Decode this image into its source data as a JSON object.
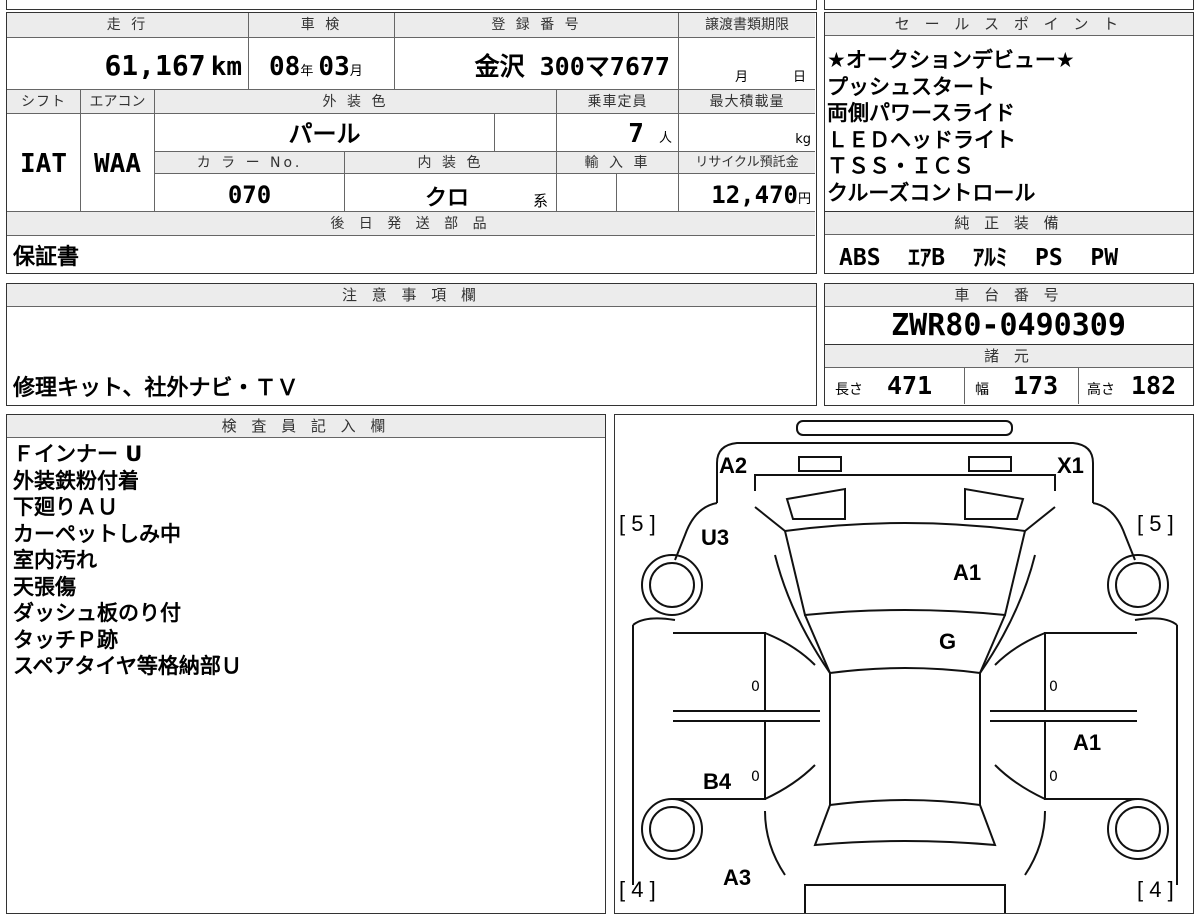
{
  "vehicle": {
    "mileage_label": "走 行",
    "mileage_value": "61,167",
    "mileage_unit": "km",
    "inspection_label": "車 検",
    "inspection_year": "08",
    "inspection_year_unit": "年",
    "inspection_month": "03",
    "inspection_month_unit": "月",
    "registration_label": "登 録 番 号",
    "registration_value": "金沢 300マ7677",
    "transfer_deadline_label": "譲渡書類期限",
    "transfer_month_unit": "月",
    "transfer_day_unit": "日",
    "shift_label": "シフト",
    "shift_value": "IAT",
    "aircon_label": "エアコン",
    "aircon_value": "WAA",
    "exterior_color_label": "外 装 色",
    "exterior_color_value": "パール",
    "capacity_label": "乗車定員",
    "capacity_value": "7",
    "capacity_unit": "人",
    "max_load_label": "最大積載量",
    "max_load_unit": "kg",
    "color_no_label": "カ ラ ー No.",
    "color_no_value": "070",
    "interior_color_label": "内 装 色",
    "interior_color_value": "クロ",
    "interior_color_suffix": "系",
    "import_label": "輸 入 車",
    "recycle_label": "リサイクル預託金",
    "recycle_value": "12,470",
    "recycle_unit": "円",
    "later_parts_label": "後 日 発 送 部 品",
    "later_parts_value": "保証書"
  },
  "sales_points": {
    "label": "セ ー ル ス ポ イ ン ト",
    "items": [
      "★オークションデビュー★",
      "プッシュスタート",
      "両側パワースライド",
      "ＬＥＤヘッドライト",
      "ＴＳＳ・ＩＣＳ",
      "クルーズコントロール"
    ]
  },
  "genuine_equipment": {
    "label": "純 正 装 備",
    "value": "ABS  ｴｱB  ｱﾙﾐ  PS  PW"
  },
  "notes": {
    "label": "注 意 事 項 欄",
    "value": "修理キット、社外ナビ・ＴＶ"
  },
  "chassis": {
    "label": "車 台 番 号",
    "value": "ZWR80-0490309"
  },
  "specs": {
    "label": "諸 元",
    "length_label": "長さ",
    "length_value": "471",
    "width_label": "幅",
    "width_value": "173",
    "height_label": "高さ",
    "height_value": "182"
  },
  "inspector": {
    "label": "検 査 員 記 入 欄",
    "lines": [
      "Ｆインナー U",
      "外装鉄粉付着",
      "下廻りＡＵ",
      "カーペットしみ中",
      "室内汚れ",
      "天張傷",
      "ダッシュ板のり付",
      "タッチＰ跡",
      "スペアタイヤ等格納部Ｕ"
    ]
  },
  "diagram": {
    "marks": [
      "A2",
      "X1",
      "U3",
      "A1",
      "G",
      "A1",
      "B4",
      "A3"
    ],
    "bracket_labels": [
      "[ 5 ]",
      "[ 5 ]",
      "[ 4 ]",
      "[ 4 ]"
    ],
    "zero_marks": [
      "0",
      "0",
      "0",
      "0"
    ]
  }
}
